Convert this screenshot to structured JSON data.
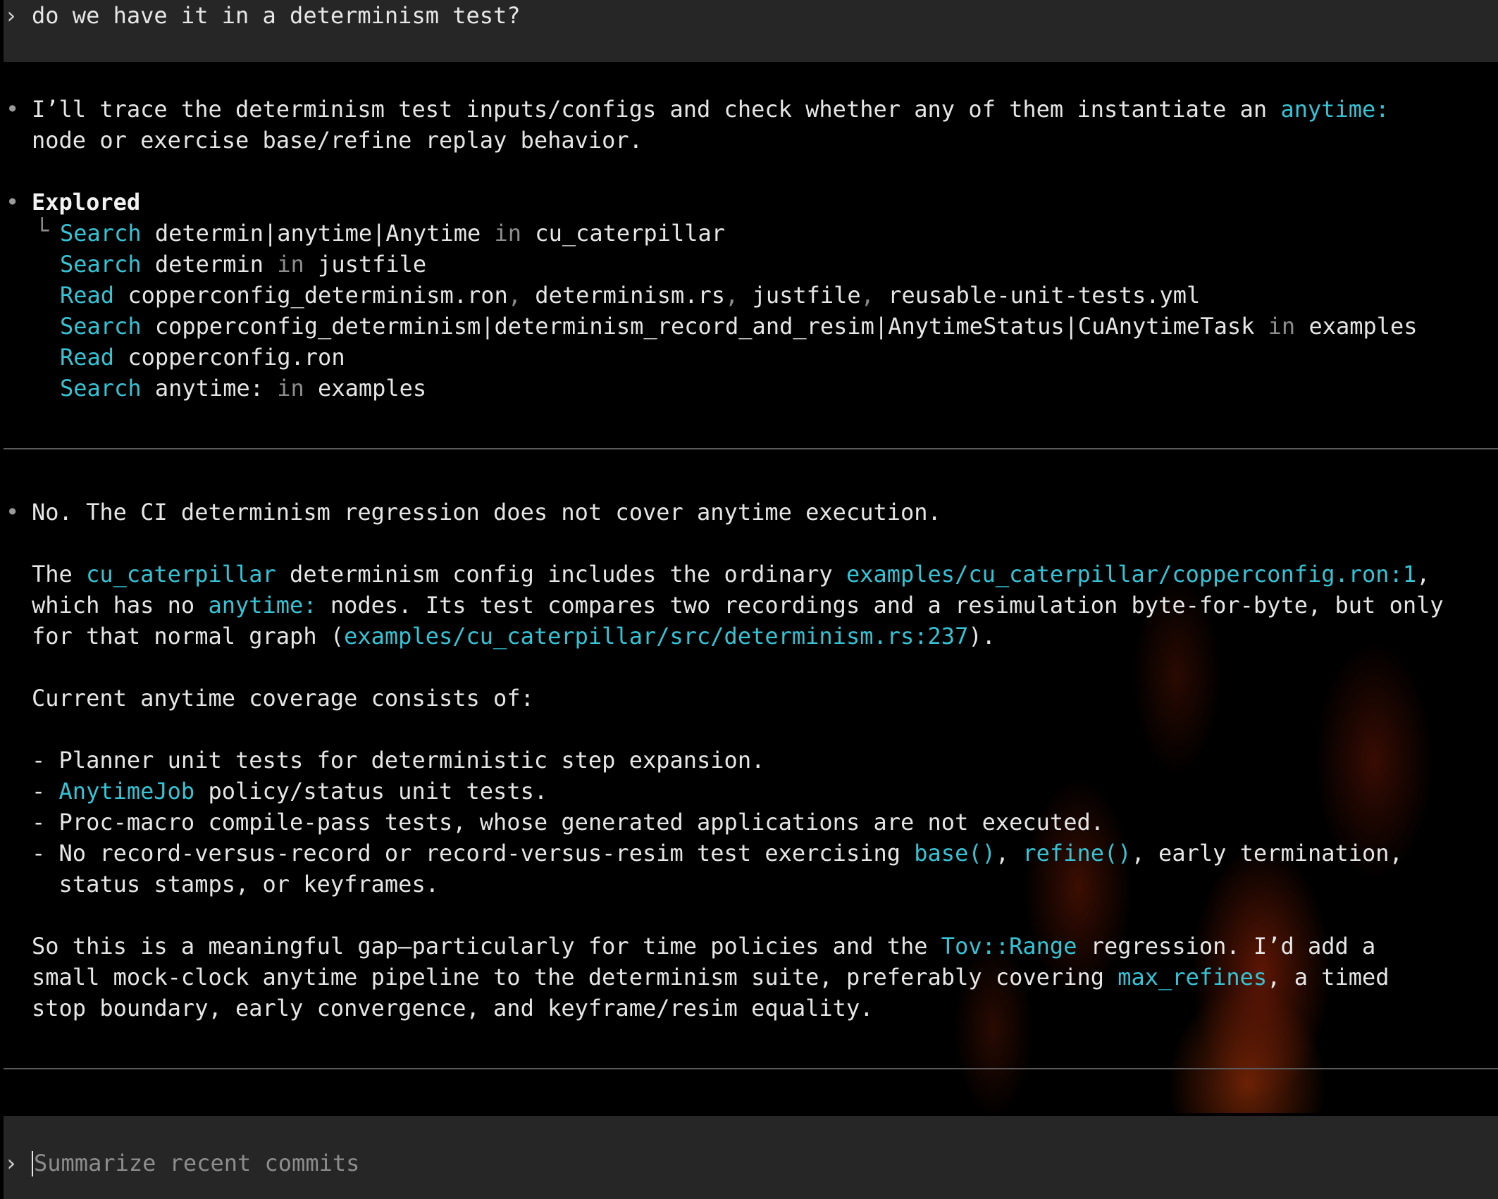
{
  "user_message": {
    "prompt_symbol": "›",
    "text": "do we have it in a determinism test?"
  },
  "bullet": "•",
  "branch": "└",
  "trace": {
    "pre": "I’ll trace the determinism test inputs/configs and check whether any of them instantiate an ",
    "code": "anytime:",
    "line2": "node or exercise base/refine replay behavior."
  },
  "explored": {
    "title": "Explored",
    "in_word": "in",
    "rows": [
      {
        "verb": "Search",
        "query": "determin|anytime|Anytime",
        "target": "cu_caterpillar"
      },
      {
        "verb": "Search",
        "query": "determin",
        "target": "justfile"
      },
      {
        "verb": "Read",
        "files": [
          "copperconfig_determinism.ron",
          "determinism.rs",
          "justfile",
          "reusable-unit-tests.yml"
        ]
      },
      {
        "verb": "Search",
        "query": "copperconfig_determinism|determinism_record_and_resim|AnytimeStatus|CuAnytimeTask",
        "target": "examples"
      },
      {
        "verb": "Read",
        "files": [
          "copperconfig.ron"
        ]
      },
      {
        "verb": "Search",
        "query": "anytime:",
        "target": "examples"
      }
    ]
  },
  "answer": {
    "headline": "No. The CI determinism regression does not cover anytime execution.",
    "p1": {
      "t1": "The ",
      "c1": "cu_caterpillar",
      "t2": " determinism config includes the ordinary ",
      "c2": "examples/cu_caterpillar/copperconfig.ron:1",
      "t3": ",",
      "t4": "which has no ",
      "c3": "anytime:",
      "t5": " nodes. Its test compares two recordings and a resimulation byte-for-byte, but only",
      "t6": "for that normal graph (",
      "c4": "examples/cu_caterpillar/src/determinism.rs:237",
      "t7": ")."
    },
    "coverage_intro": "Current anytime coverage consists of:",
    "items": {
      "i1": "- Planner unit tests for deterministic step expansion.",
      "i2_dash": "- ",
      "i2_code": "AnytimeJob",
      "i2_rest": " policy/status unit tests.",
      "i3": "- Proc-macro compile-pass tests, whose generated applications are not executed.",
      "i4_a": "- No record-versus-record or record-versus-resim test exercising ",
      "i4_c1": "base()",
      "i4_b": ", ",
      "i4_c2": "refine()",
      "i4_d": ", early termination,",
      "i4_cont": "  status stamps, or keyframes."
    },
    "p2": {
      "t1": "So this is a meaningful gap—particularly for time policies and the ",
      "c1": "Tov::Range",
      "t2": " regression. I’d add a",
      "t3": "small mock-clock anytime pipeline to the determinism suite, preferably covering ",
      "c2": "max_refines",
      "t4": ", a timed",
      "t5": "stop boundary, early convergence, and keyframe/resim equality."
    }
  },
  "composer": {
    "prompt_symbol": "›",
    "placeholder": "Summarize recent commits"
  },
  "colors": {
    "accent": "#35c4d6",
    "text": "#e6e6e6",
    "dim": "#8d8d8d",
    "bar": "#262626"
  }
}
